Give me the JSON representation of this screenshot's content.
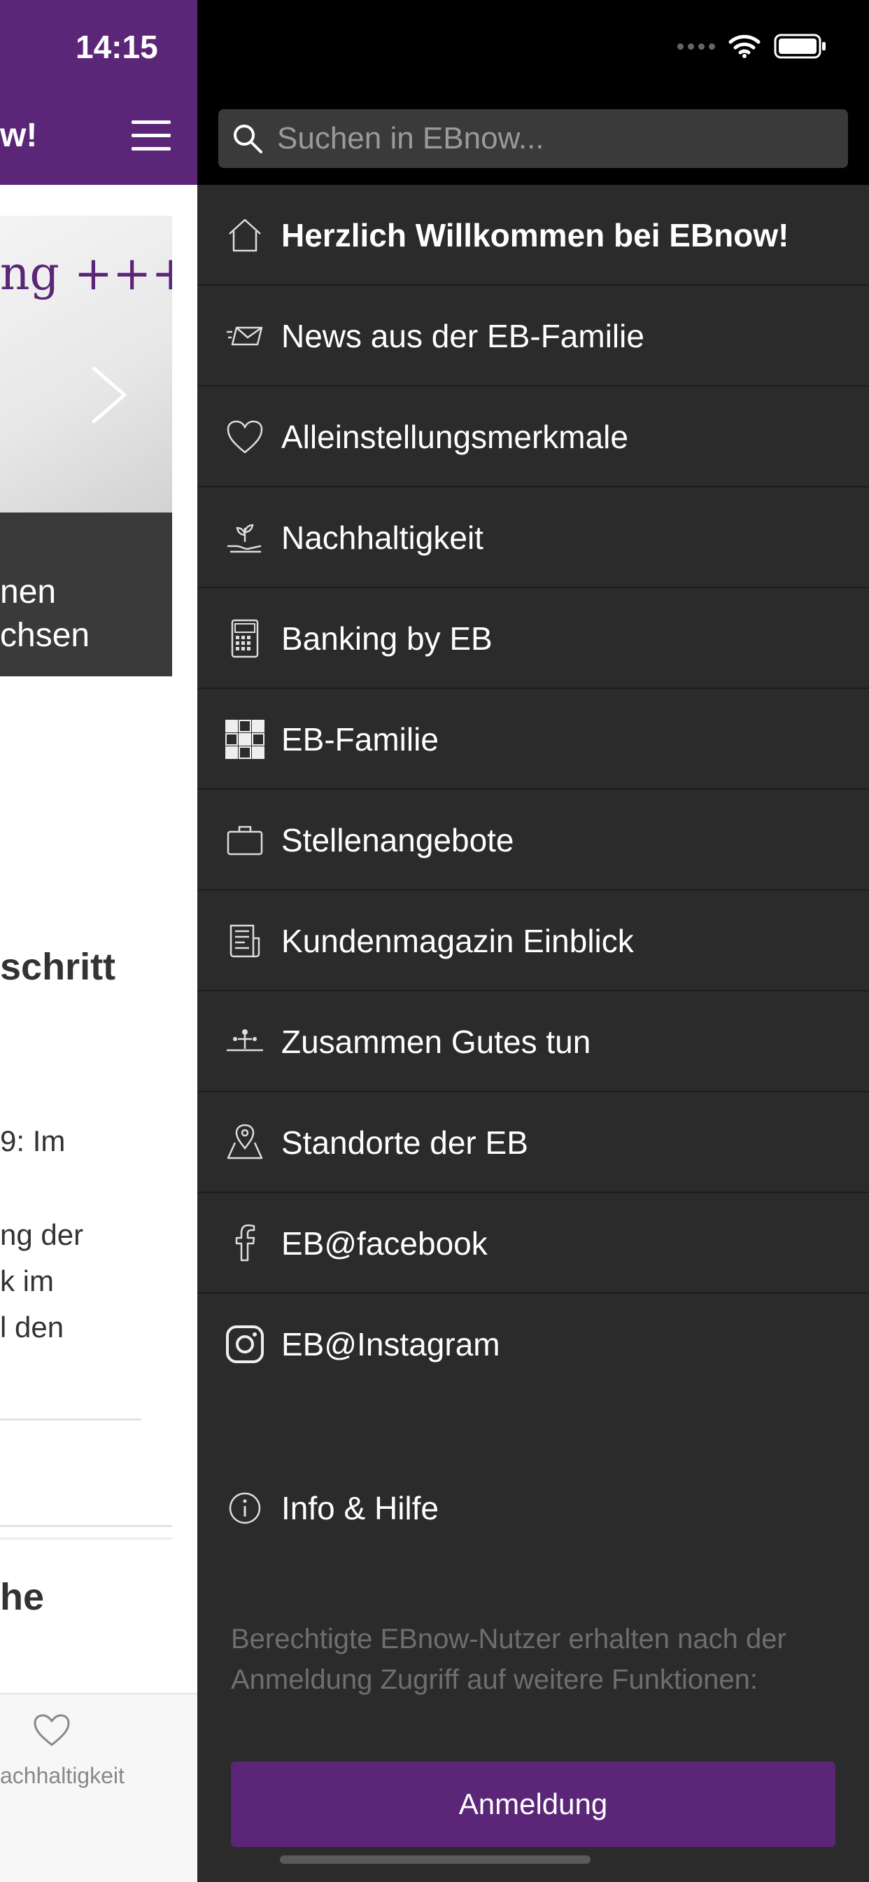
{
  "status_bar": {
    "time": "14:15"
  },
  "background_screen": {
    "title_fragment": "w!",
    "banner_text": "ng +++ F",
    "dark_box_lines": [
      "nen",
      "chsen"
    ],
    "heading": "schritt",
    "paragraph_lines": [
      "9: Im",
      "ng der",
      "k im",
      "l den"
    ],
    "heading2": "he",
    "tab_label": "achhaltigkeit"
  },
  "drawer": {
    "search": {
      "placeholder": "Suchen in EBnow..."
    },
    "items": [
      {
        "label": "Herzlich Willkommen bei EBnow!",
        "icon": "home-icon"
      },
      {
        "label": "News aus der EB-Familie",
        "icon": "envelope-icon"
      },
      {
        "label": "Alleinstellungsmerkmale",
        "icon": "heart-icon"
      },
      {
        "label": "Nachhaltigkeit",
        "icon": "plant-hand-icon"
      },
      {
        "label": "Banking by EB",
        "icon": "calculator-icon"
      },
      {
        "label": "EB-Familie",
        "icon": "checker-grid-icon"
      },
      {
        "label": "Stellenangebote",
        "icon": "briefcase-icon"
      },
      {
        "label": "Kundenmagazin Einblick",
        "icon": "magazine-icon"
      },
      {
        "label": "Zusammen Gutes tun",
        "icon": "community-icon"
      },
      {
        "label": "Standorte der EB",
        "icon": "map-pin-icon"
      },
      {
        "label": "EB@facebook",
        "icon": "facebook-icon"
      },
      {
        "label": "EB@Instagram",
        "icon": "instagram-icon"
      }
    ],
    "info": {
      "label": "Info & Hilfe",
      "icon": "info-icon"
    },
    "login_hint": "Berechtigte EBnow-Nutzer erhalten nach der Anmeldung Zugriff auf weitere Funktionen:",
    "login_button": "Anmeldung"
  },
  "colors": {
    "brand_purple": "#5b2678",
    "drawer_bg": "#2b2b2b",
    "search_bg": "#3a3a3a"
  }
}
